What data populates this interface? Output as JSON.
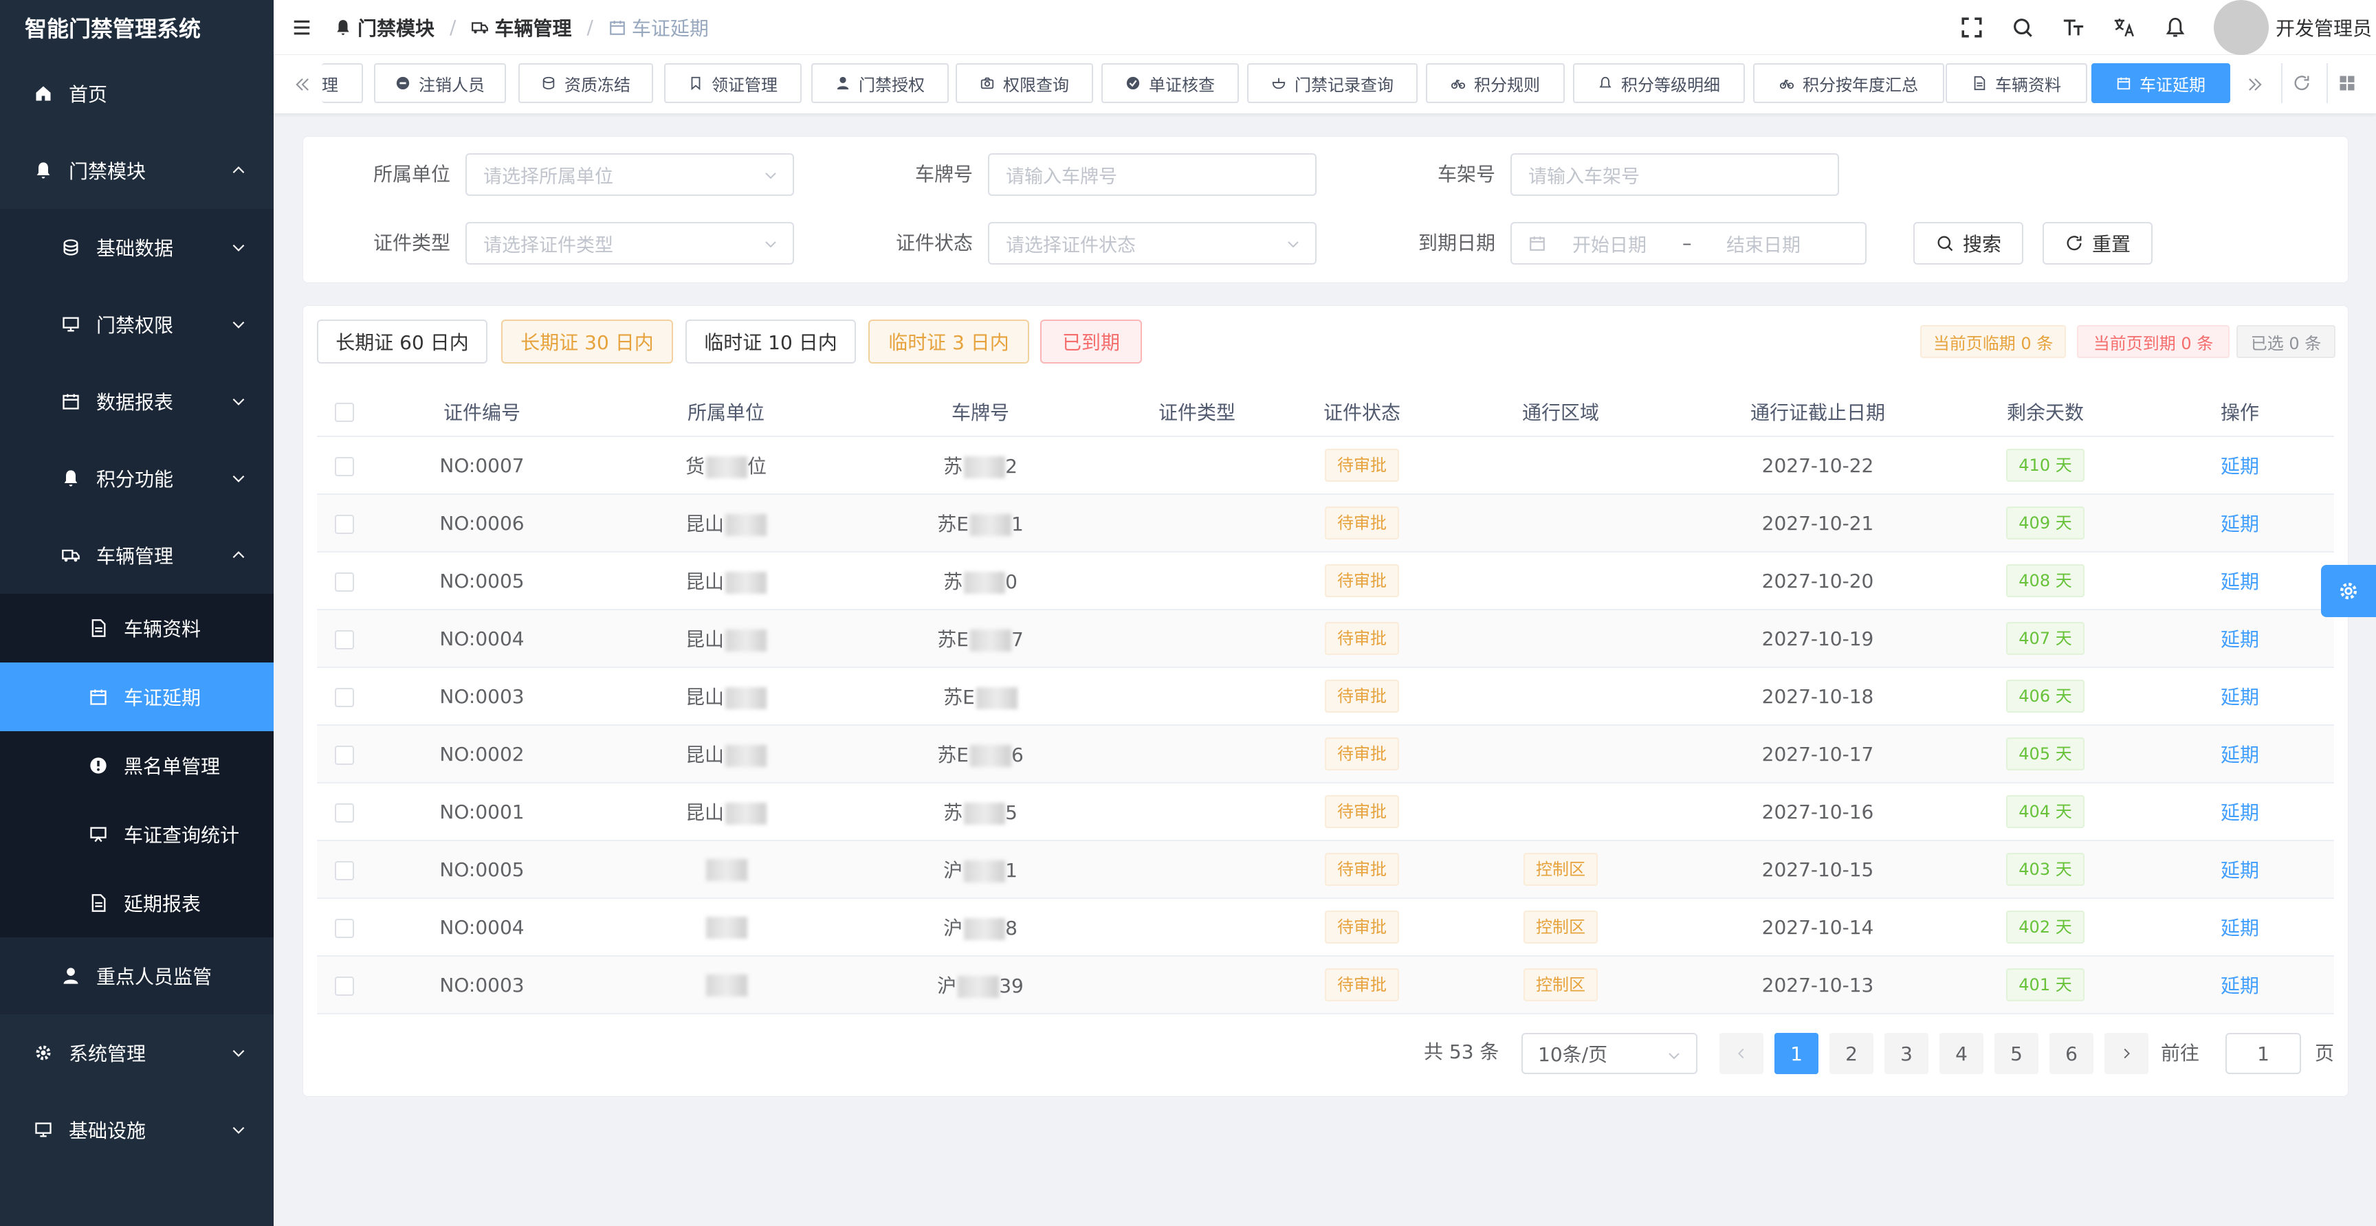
{
  "app_title": "智能门禁管理系统",
  "sidebar": {
    "home": "首页",
    "access_module": "门禁模块",
    "access_children": [
      "基础数据",
      "门禁权限",
      "数据报表",
      "积分功能"
    ],
    "vehicle_mgmt": "车辆管理",
    "vehicle_children": [
      "车辆资料",
      "车证延期",
      "黑名单管理",
      "车证查询统计",
      "延期报表"
    ],
    "key_person": "重点人员监管",
    "system_mgmt": "系统管理",
    "infra": "基础设施"
  },
  "header": {
    "breadcrumb": [
      "门禁模块",
      "车辆管理",
      "车证延期"
    ],
    "username": "开发管理员"
  },
  "tags": [
    "理",
    "注销人员",
    "资质冻结",
    "领证管理",
    "门禁授权",
    "权限查询",
    "单证核查",
    "门禁记录查询",
    "积分规则",
    "积分等级明细",
    "积分按年度汇总",
    "车辆资料",
    "车证延期"
  ],
  "filters": {
    "unit_label": "所属单位",
    "unit_placeholder": "请选择所属单位",
    "plate_label": "车牌号",
    "plate_placeholder": "请输入车牌号",
    "frame_label": "车架号",
    "frame_placeholder": "请输入车架号",
    "cert_type_label": "证件类型",
    "cert_type_placeholder": "请选择证件类型",
    "cert_status_label": "证件状态",
    "cert_status_placeholder": "请选择证件状态",
    "expire_label": "到期日期",
    "start_placeholder": "开始日期",
    "range_sep": "–",
    "end_placeholder": "结束日期",
    "search_btn": "搜索",
    "reset_btn": "重置"
  },
  "quick_filters": [
    "长期证 60 日内",
    "长期证 30 日内",
    "临时证 10 日内",
    "临时证 3 日内",
    "已到期"
  ],
  "stats": {
    "near_expire": "当前页临期 0 条",
    "expired": "当前页到期 0 条",
    "selected": "已选 0 条"
  },
  "table": {
    "headers": [
      "证件编号",
      "所属单位",
      "车牌号",
      "证件类型",
      "证件状态",
      "通行区域",
      "通行证截止日期",
      "剩余天数",
      "操作"
    ],
    "rows": [
      {
        "no": "NO:0007",
        "unit": "货",
        "unit_tail": "位",
        "plate": "苏",
        "plate_tail": "2",
        "type": "",
        "status": "待审批",
        "area": "",
        "date": "2027-10-22",
        "days": "410 天",
        "op": "延期"
      },
      {
        "no": "NO:0006",
        "unit": "昆山",
        "unit_tail": "",
        "plate": "苏E",
        "plate_tail": "1",
        "type": "",
        "status": "待审批",
        "area": "",
        "date": "2027-10-21",
        "days": "409 天",
        "op": "延期"
      },
      {
        "no": "NO:0005",
        "unit": "昆山",
        "unit_tail": "",
        "plate": "苏",
        "plate_tail": "0",
        "type": "",
        "status": "待审批",
        "area": "",
        "date": "2027-10-20",
        "days": "408 天",
        "op": "延期"
      },
      {
        "no": "NO:0004",
        "unit": "昆山",
        "unit_tail": "",
        "plate": "苏E",
        "plate_tail": "7",
        "type": "",
        "status": "待审批",
        "area": "",
        "date": "2027-10-19",
        "days": "407 天",
        "op": "延期"
      },
      {
        "no": "NO:0003",
        "unit": "昆山",
        "unit_tail": "",
        "plate": "苏E",
        "plate_tail": "",
        "type": "",
        "status": "待审批",
        "area": "",
        "date": "2027-10-18",
        "days": "406 天",
        "op": "延期"
      },
      {
        "no": "NO:0002",
        "unit": "昆山",
        "unit_tail": "",
        "plate": "苏E",
        "plate_tail": "6",
        "type": "",
        "status": "待审批",
        "area": "",
        "date": "2027-10-17",
        "days": "405 天",
        "op": "延期"
      },
      {
        "no": "NO:0001",
        "unit": "昆山",
        "unit_tail": "",
        "plate": "苏",
        "plate_tail": "5",
        "type": "",
        "status": "待审批",
        "area": "",
        "date": "2027-10-16",
        "days": "404 天",
        "op": "延期"
      },
      {
        "no": "NO:0005",
        "unit": "",
        "unit_tail": "",
        "plate": "沪",
        "plate_tail": "1",
        "type": "",
        "status": "待审批",
        "area": "控制区",
        "date": "2027-10-15",
        "days": "403 天",
        "op": "延期"
      },
      {
        "no": "NO:0004",
        "unit": "",
        "unit_tail": "",
        "plate": "沪",
        "plate_tail": "8",
        "type": "",
        "status": "待审批",
        "area": "控制区",
        "date": "2027-10-14",
        "days": "402 天",
        "op": "延期"
      },
      {
        "no": "NO:0003",
        "unit": "",
        "unit_tail": "",
        "plate": "沪",
        "plate_tail": "39",
        "type": "",
        "status": "待审批",
        "area": "控制区",
        "date": "2027-10-13",
        "days": "401 天",
        "op": "延期"
      }
    ]
  },
  "pagination": {
    "total": "共 53 条",
    "page_size": "10条/页",
    "pages": [
      "1",
      "2",
      "3",
      "4",
      "5",
      "6"
    ],
    "goto_label": "前往",
    "goto_value": "1",
    "goto_unit": "页"
  },
  "colors": {
    "sidebar_bg": "#1f2d3d",
    "accent": "#409eff",
    "warning": "#e6a23c",
    "danger": "#f56c6c",
    "success": "#67c23a"
  },
  "icons": {
    "home": "home-icon",
    "bell": "bell-icon",
    "vehicle": "truck-icon",
    "gear": "gear-icon",
    "monitor": "monitor-icon"
  }
}
